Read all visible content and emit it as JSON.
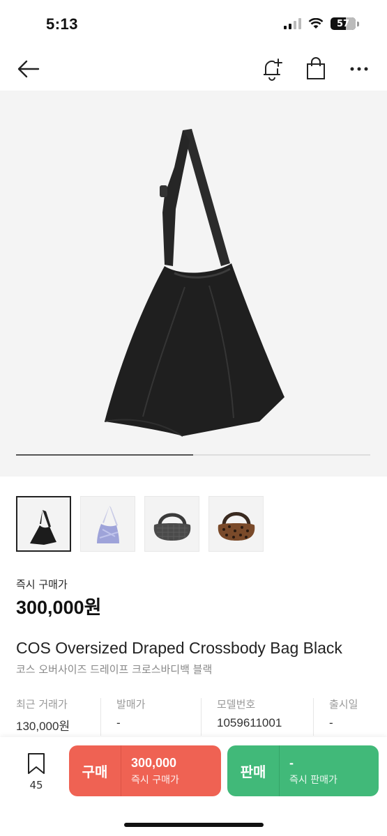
{
  "status_bar": {
    "time": "5:13",
    "battery": "57"
  },
  "nav": {
    "back_icon": "arrow-left-icon",
    "icons": [
      "bell-plus-icon",
      "shopping-bag-icon",
      "more-icon"
    ]
  },
  "gallery": {
    "progress_fraction": 0.5,
    "thumbnails": [
      "black-bag",
      "lavender-bag",
      "gray-quilted-bag",
      "leopard-bag"
    ],
    "selected_index": 0
  },
  "product": {
    "buy_now_label": "즉시 구매가",
    "price": "300,000원",
    "title_en": "COS Oversized Draped Crossbody Bag Black",
    "title_ko": "코스 오버사이즈 드레이프 크로스바디백 블랙"
  },
  "info": [
    {
      "label": "최근 거래가",
      "value": "130,000원"
    },
    {
      "label": "발매가",
      "value": "-"
    },
    {
      "label": "모델번호",
      "value": "1059611001"
    },
    {
      "label": "출시일",
      "value": "-"
    }
  ],
  "bottom": {
    "wish_count": "45",
    "buy": {
      "kind": "구매",
      "amount": "300,000",
      "sub": "즉시 구매가",
      "color": "#ef6253"
    },
    "sell": {
      "kind": "판매",
      "amount": "-",
      "sub": "즉시 판매가",
      "color": "#41b979"
    }
  }
}
